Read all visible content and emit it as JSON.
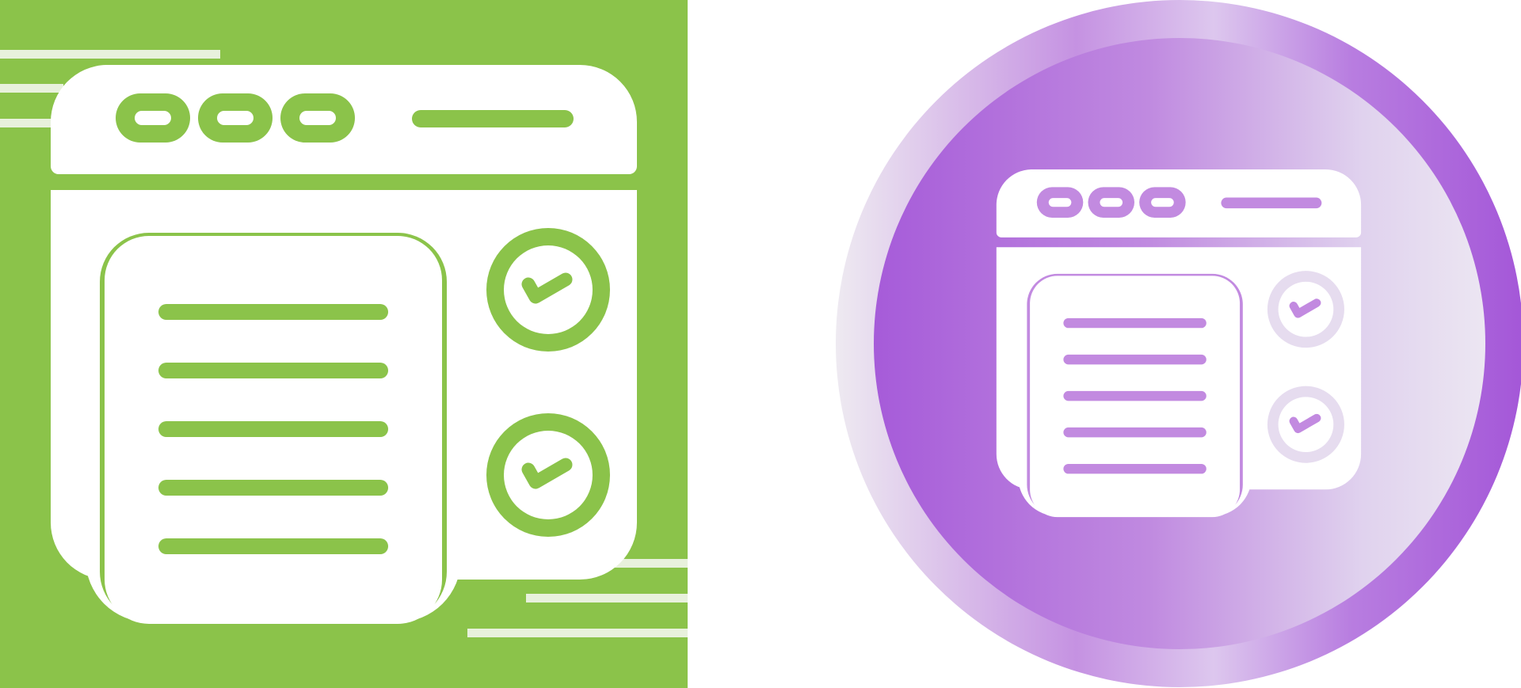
{
  "colors": {
    "background": "#ffffff",
    "green_tile": "#8bc34a",
    "green_glyph": "#ffffff",
    "green_accent_lines": "#e8f1dc",
    "purple_dark": "#a259d9",
    "purple_mid": "#c28ae0",
    "purple_light": "#e6dcef",
    "purple_outer_edge": "#eeeaf1",
    "purple_glyph": "#ffffff"
  },
  "icons": [
    {
      "name": "browser-checklist-icon",
      "variant": "glyph-on-square",
      "elements": [
        "browser-window-icon",
        "window-dots-icon",
        "address-bar-icon",
        "document-list-icon",
        "check-circle-icon",
        "check-circle-icon"
      ],
      "list_lines": 5,
      "check_marks": 2
    },
    {
      "name": "browser-checklist-icon",
      "variant": "gradient-circle",
      "elements": [
        "browser-window-icon",
        "window-dots-icon",
        "address-bar-icon",
        "document-list-icon",
        "check-circle-icon",
        "check-circle-icon"
      ],
      "list_lines": 5,
      "check_marks": 2
    }
  ]
}
